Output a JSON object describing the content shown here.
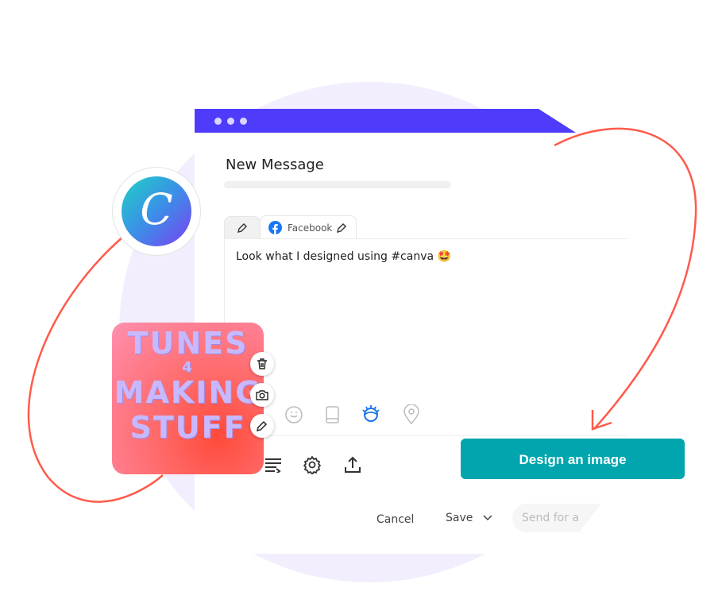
{
  "window": {
    "title": "New Message",
    "tabs": [
      {
        "icon": "pencil-icon"
      },
      {
        "label": "Facebook",
        "icon": "facebook-icon"
      }
    ],
    "message": "Look what I designed using #canva 🤩",
    "toolbar_icons": [
      "smiley-icon",
      "book-icon",
      "eye-icon",
      "location-pin-icon"
    ],
    "bottom_icons": [
      "queue-icon",
      "gear-icon",
      "upload-icon"
    ],
    "footer": {
      "cancel": "Cancel",
      "save": "Save",
      "send": "Send for a"
    }
  },
  "logo": {
    "letter": "C",
    "name": "Canva"
  },
  "image_card": {
    "line1": "TUNES",
    "line2": "4",
    "line3": "MAKING",
    "line4": "STUFF",
    "actions": [
      "trash-icon",
      "camera-icon",
      "pencil-icon"
    ]
  },
  "cta": {
    "label": "Design an image"
  },
  "colors": {
    "header": "#4f3cfb",
    "cta": "#00a5ad",
    "accent_curve": "#ff5a4a",
    "eye_active": "#1a73e8",
    "background_circle": "#f2eefd"
  }
}
